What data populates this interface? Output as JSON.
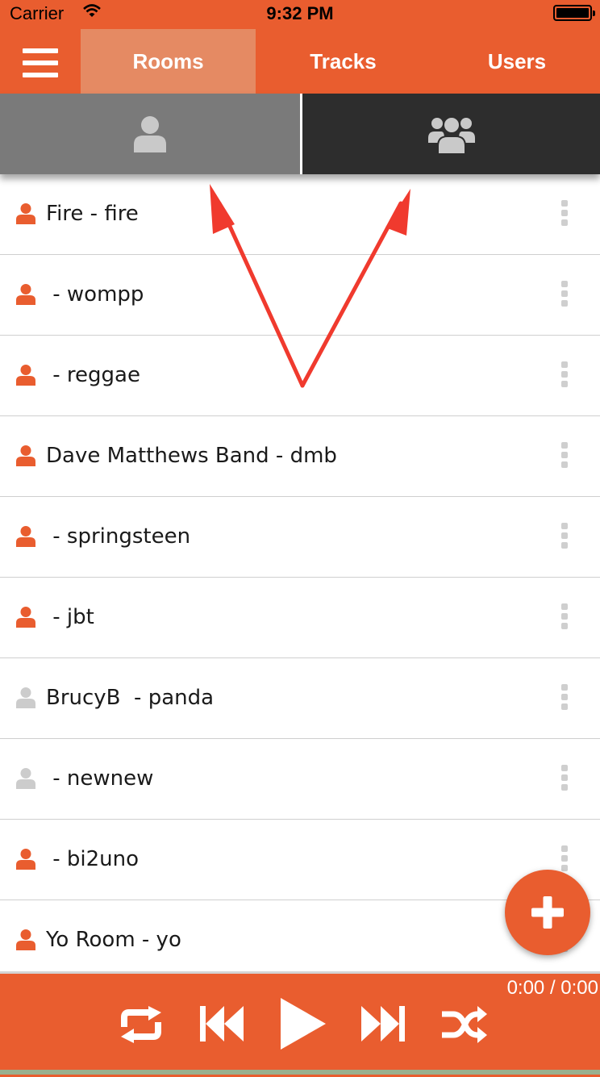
{
  "status_bar": {
    "carrier": "Carrier",
    "time": "9:32 PM"
  },
  "nav": {
    "tabs": [
      {
        "label": "Rooms",
        "active": true
      },
      {
        "label": "Tracks",
        "active": false
      },
      {
        "label": "Users",
        "active": false
      }
    ]
  },
  "segments": [
    {
      "icon": "single-user-icon",
      "selected": true
    },
    {
      "icon": "group-users-icon",
      "selected": false
    }
  ],
  "rooms": [
    {
      "name": "Fire - fire",
      "owner_active": true
    },
    {
      "name": " - wompp",
      "owner_active": true
    },
    {
      "name": " - reggae",
      "owner_active": true
    },
    {
      "name": "Dave Matthews Band - dmb",
      "owner_active": true
    },
    {
      "name": " - springsteen",
      "owner_active": true
    },
    {
      "name": " - jbt",
      "owner_active": true
    },
    {
      "name": "BrucyB  - panda",
      "owner_active": false
    },
    {
      "name": " - newnew",
      "owner_active": false
    },
    {
      "name": " - bi2uno",
      "owner_active": true
    },
    {
      "name": "Yo Room - yo",
      "owner_active": true
    }
  ],
  "player": {
    "timecode": "0:00 / 0:00",
    "controls": [
      "repeat-icon",
      "previous-icon",
      "play-icon",
      "next-icon",
      "shuffle-icon"
    ]
  },
  "colors": {
    "accent": "#e95d2f",
    "active_tab": "#e58a63",
    "user_active": "#e95d2f",
    "user_inactive": "#cccccc",
    "annotation_arrow": "#f03a2e"
  }
}
